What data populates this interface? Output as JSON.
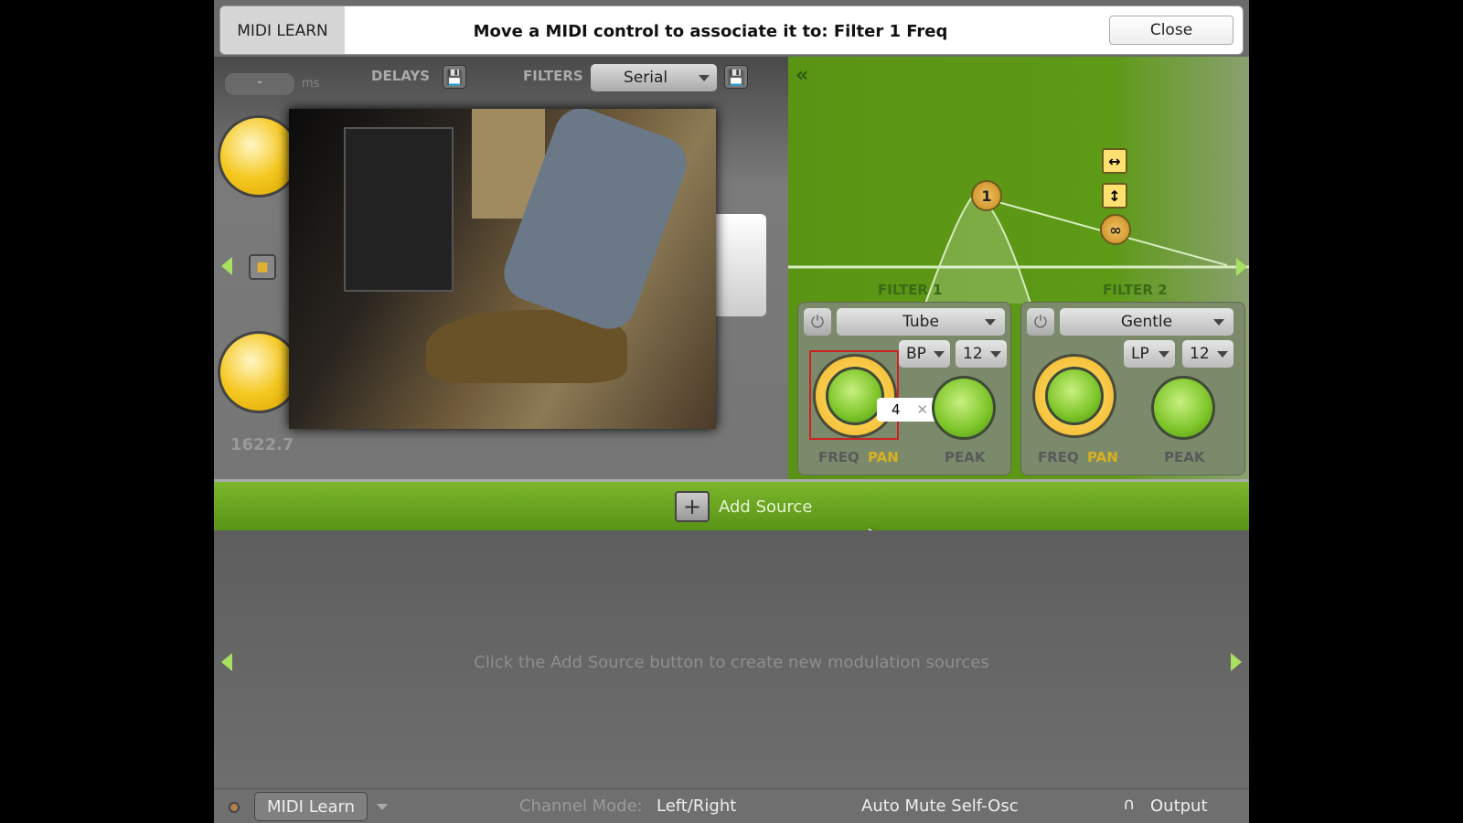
{
  "midi_learn_bar": {
    "tag": "MIDI LEARN",
    "message": "Move a MIDI control to associate it to: Filter 1 Freq",
    "close_label": "Close"
  },
  "toolbar": {
    "time_value": "-",
    "time_unit": "ms",
    "delays_label": "DELAYS",
    "filters_label": "FILTERS",
    "filter_routing": "Serial"
  },
  "left_panel": {
    "readout": "1622.7"
  },
  "graph": {
    "collapse_icon": "«",
    "node_label": "1",
    "link_icon": "∞"
  },
  "filters": [
    {
      "title": "FILTER 1",
      "model": "Tube",
      "type": "BP",
      "slope": "12",
      "freq_label": "FREQ",
      "pan_label": "PAN",
      "peak_label": "PEAK",
      "midi_cc": "4"
    },
    {
      "title": "FILTER 2",
      "model": "Gentle",
      "type": "LP",
      "slope": "12",
      "freq_label": "FREQ",
      "pan_label": "PAN",
      "peak_label": "PEAK"
    }
  ],
  "modulation": {
    "add_source_label": "Add Source",
    "empty_hint": "Click the Add Source button to create new modulation sources"
  },
  "status_bar": {
    "midi_learn_label": "MIDI Learn",
    "channel_mode_label": "Channel Mode:",
    "channel_mode_value": "Left/Right",
    "auto_mute_label": "Auto Mute Self-Osc",
    "output_label": "Output"
  },
  "colors": {
    "accent_green": "#5d9a16",
    "knob_yellow": "#f5c820",
    "midi_highlight": "#cc2222"
  }
}
